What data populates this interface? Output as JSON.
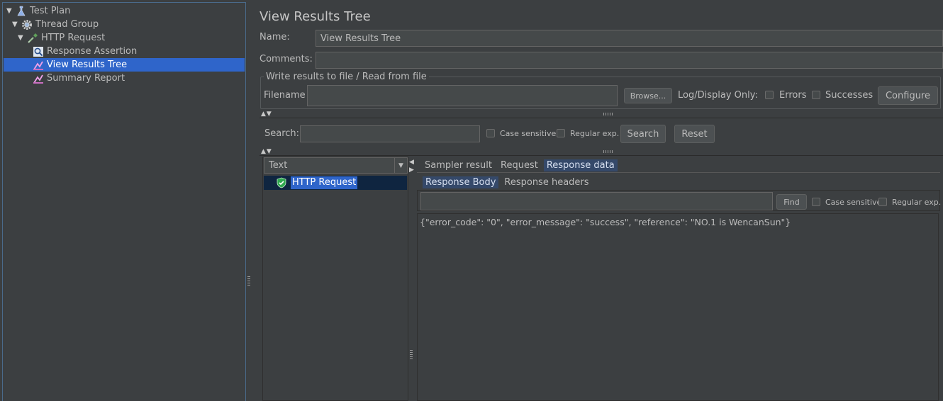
{
  "tree": {
    "items": [
      {
        "label": "Test Plan",
        "icon": "test-plan-icon",
        "expanded": true
      },
      {
        "label": "Thread Group",
        "icon": "gear-icon",
        "expanded": true
      },
      {
        "label": "HTTP Request",
        "icon": "pipette-icon",
        "expanded": true
      },
      {
        "label": "Response Assertion",
        "icon": "magnifier-icon"
      },
      {
        "label": "View Results Tree",
        "icon": "chart-icon",
        "selected": true
      },
      {
        "label": "Summary Report",
        "icon": "chart-icon"
      }
    ]
  },
  "panel": {
    "title": "View Results Tree",
    "name_label": "Name:",
    "name_value": "View Results Tree",
    "comments_label": "Comments:",
    "comments_value": "",
    "file_section_title": "Write results to file / Read from file",
    "filename_label": "Filename",
    "filename_value": "",
    "browse_label": "Browse...",
    "log_display_label": "Log/Display Only:",
    "errors_label": "Errors",
    "successes_label": "Successes",
    "configure_label": "Configure"
  },
  "search": {
    "label": "Search:",
    "value": "",
    "case_sensitive_label": "Case sensitive",
    "regex_label": "Regular exp.",
    "search_button": "Search",
    "reset_button": "Reset"
  },
  "results": {
    "renderer_selected": "Text",
    "samples": [
      {
        "label": "HTTP Request",
        "status": "success"
      }
    ],
    "tabs": [
      "Sampler result",
      "Request",
      "Response data"
    ],
    "active_tab": "Response data",
    "subtabs": [
      "Response Body",
      "Response headers"
    ],
    "active_subtab": "Response Body",
    "find_value": "",
    "find_button": "Find",
    "find_case_label": "Case sensitive",
    "find_regex_label": "Regular exp.",
    "response_body": "{\"error_code\": \"0\", \"error_message\": \"success\", \"reference\": \"NO.1 is WencanSun\"}"
  },
  "colors": {
    "background": "#3c3f41",
    "selection": "#2f65ca",
    "tab_selected": "#35496a",
    "success_icon": "#2fa84f"
  }
}
